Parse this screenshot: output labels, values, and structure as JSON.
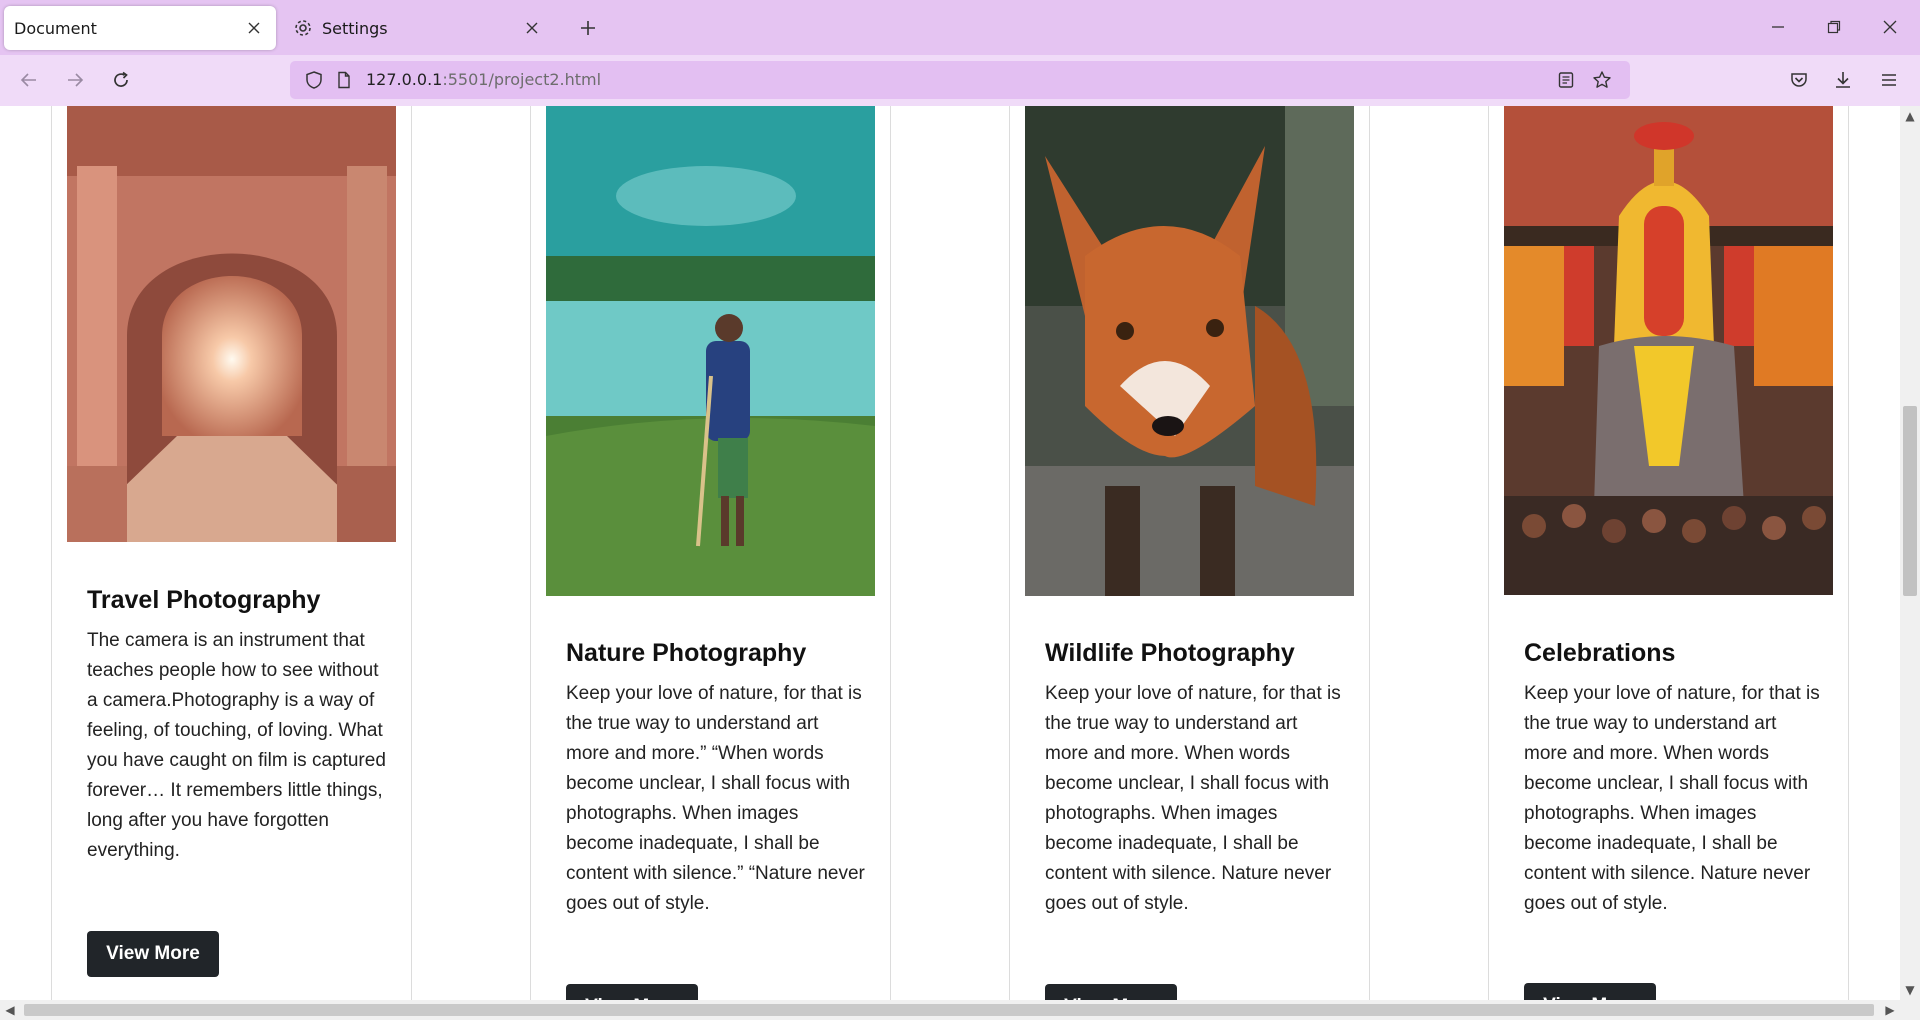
{
  "browser": {
    "tabs": [
      {
        "title": "Document",
        "active": true
      },
      {
        "title": "Settings",
        "active": false,
        "icon": "gear-icon"
      }
    ],
    "url_host": "127.0.0.1",
    "url_rest": ":5501/project2.html",
    "accent": "#e5c4f2"
  },
  "cards": [
    {
      "title": "Travel Photography",
      "text": "The camera is an instrument that teaches people how to see without a camera.Photography is a way of feeling, of touching, of loving. What you have caught on film is captured forever… It remembers little things, long after you have forgotten everything.",
      "button": "View More",
      "image": "archway-photo"
    },
    {
      "title": "Nature Photography",
      "text": "Keep your love of nature, for that is the true way to understand art more and more.” “When words become unclear, I shall focus with photographs. When images become inadequate, I shall be content with silence.” “Nature never goes out of style.",
      "button": "View More",
      "image": "farmer-by-lake-photo"
    },
    {
      "title": "Wildlife Photography",
      "text": "Keep your love of nature, for that is the true way to understand art more and more. When words become unclear, I shall focus with photographs. When images become inadequate, I shall be content with silence. Nature never goes out of style.",
      "button": "View More",
      "image": "fox-photo"
    },
    {
      "title": "Celebrations",
      "text": "Keep your love of nature, for that is the true way to understand art more and more. When words become unclear, I shall focus with photographs. When images become inadequate, I shall be content with silence. Nature never goes out of style.",
      "button": "View More",
      "image": "festival-elephant-photo"
    }
  ]
}
